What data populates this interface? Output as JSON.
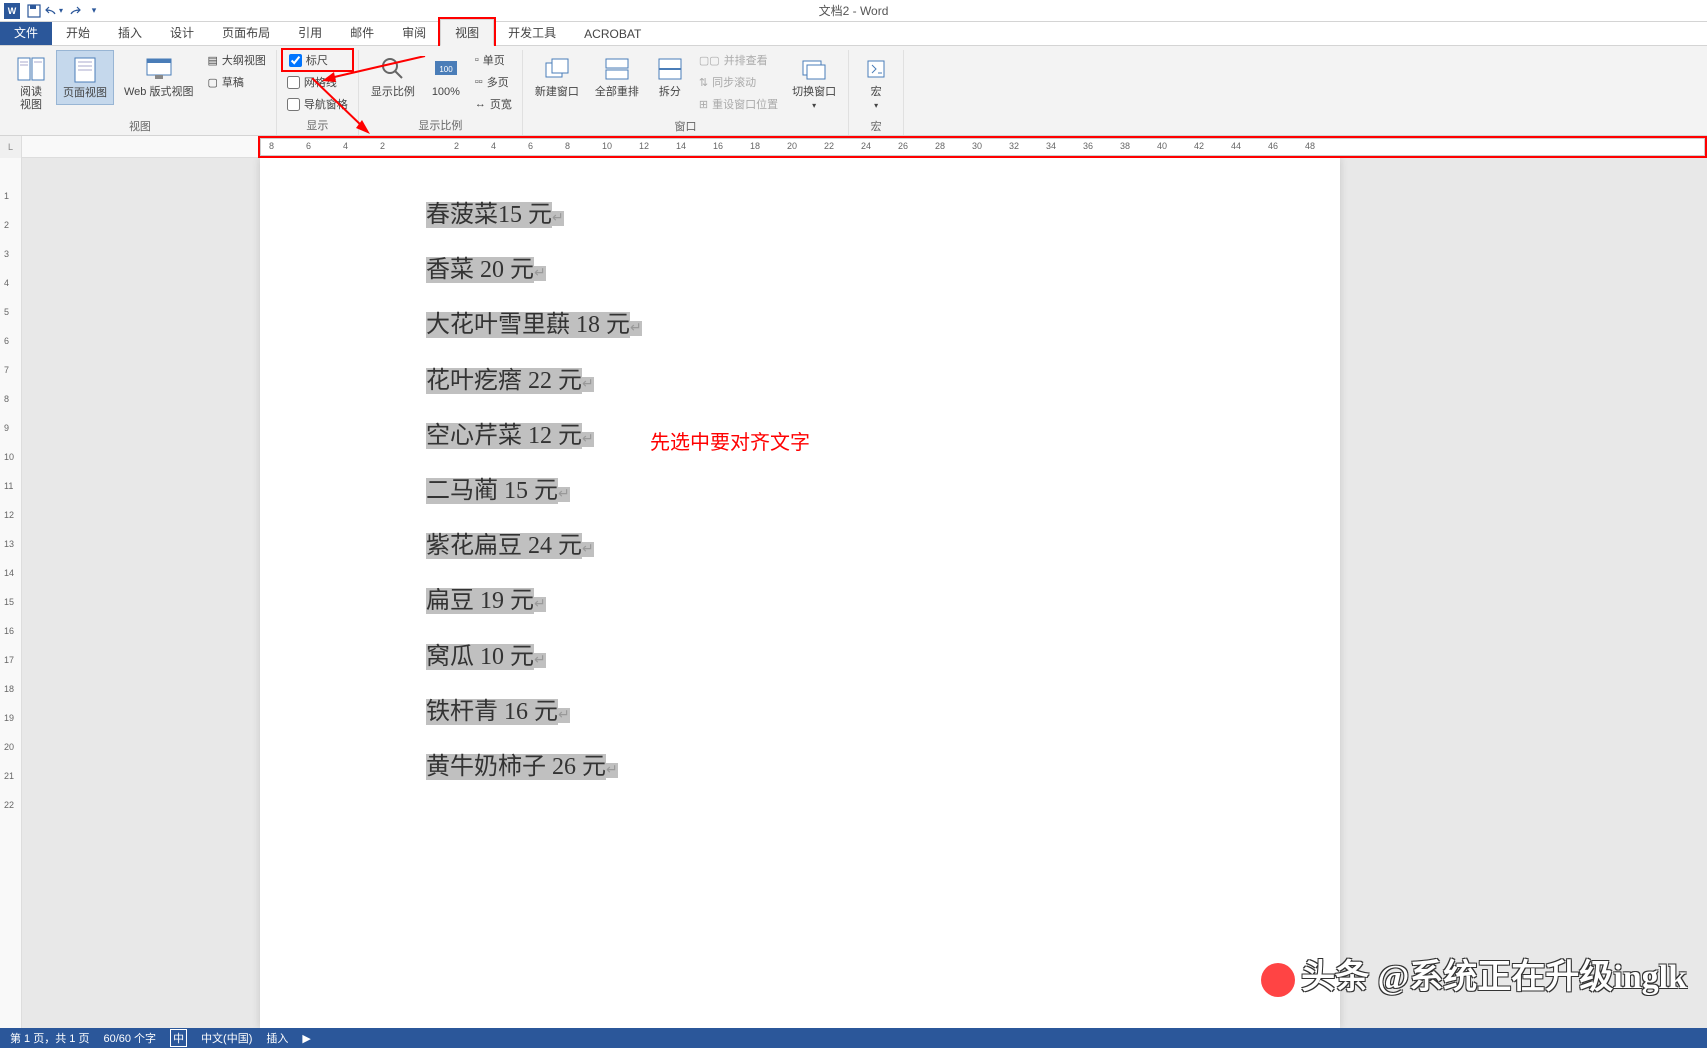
{
  "title": "文档2 - Word",
  "qat": {
    "save": "保存",
    "undo": "撤销",
    "redo": "重做"
  },
  "tabs": {
    "file": "文件",
    "items": [
      "开始",
      "插入",
      "设计",
      "页面布局",
      "引用",
      "邮件",
      "审阅",
      "视图",
      "开发工具",
      "ACROBAT"
    ],
    "active_index": 7
  },
  "ribbon": {
    "views_group": {
      "label": "视图",
      "read_view": "阅读\n视图",
      "page_view": "页面视图",
      "web_view": "Web 版式视图",
      "outline": "大纲视图",
      "draft": "草稿"
    },
    "show_group": {
      "label": "显示",
      "ruler": "标尺",
      "gridlines": "网格线",
      "nav_pane": "导航窗格"
    },
    "zoom_group": {
      "label": "显示比例",
      "zoom": "显示比例",
      "hundred": "100%",
      "one_page": "单页",
      "multi_page": "多页",
      "page_width": "页宽"
    },
    "window_group": {
      "label": "窗口",
      "new_window": "新建窗口",
      "arrange_all": "全部重排",
      "split": "拆分",
      "side_by_side": "并排查看",
      "sync_scroll": "同步滚动",
      "reset_pos": "重设窗口位置",
      "switch_window": "切换窗口"
    },
    "macros_group": {
      "label": "宏",
      "macros": "宏"
    }
  },
  "ruler_h": [
    8,
    6,
    4,
    2,
    "",
    2,
    4,
    6,
    8,
    10,
    12,
    14,
    16,
    18,
    20,
    22,
    24,
    26,
    28,
    30,
    32,
    34,
    36,
    38,
    40,
    42,
    44,
    46,
    48
  ],
  "ruler_v": [
    "",
    1,
    2,
    3,
    4,
    5,
    6,
    7,
    8,
    9,
    10,
    11,
    12,
    13,
    14,
    15,
    16,
    17,
    18,
    19,
    20,
    21,
    22
  ],
  "doc_lines": [
    "春菠菜15 元",
    "香菜 20 元",
    "大花叶雪里蕻 18 元",
    "花叶疙瘩 22 元",
    "空心芹菜 12 元",
    "二马蔺 15 元",
    "紫花扁豆 24 元",
    "扁豆 19 元",
    "窝瓜 10 元",
    "铁杆青 16 元",
    "黄牛奶柿子 26 元"
  ],
  "annotation": "先选中要对齐文字",
  "status": {
    "page": "第 1 页，共 1 页",
    "words": "60/60 个字",
    "lang_icon": "中",
    "lang": "中文(中国)",
    "insert": "插入"
  },
  "watermark": "头条 @系统正在升级inglk"
}
